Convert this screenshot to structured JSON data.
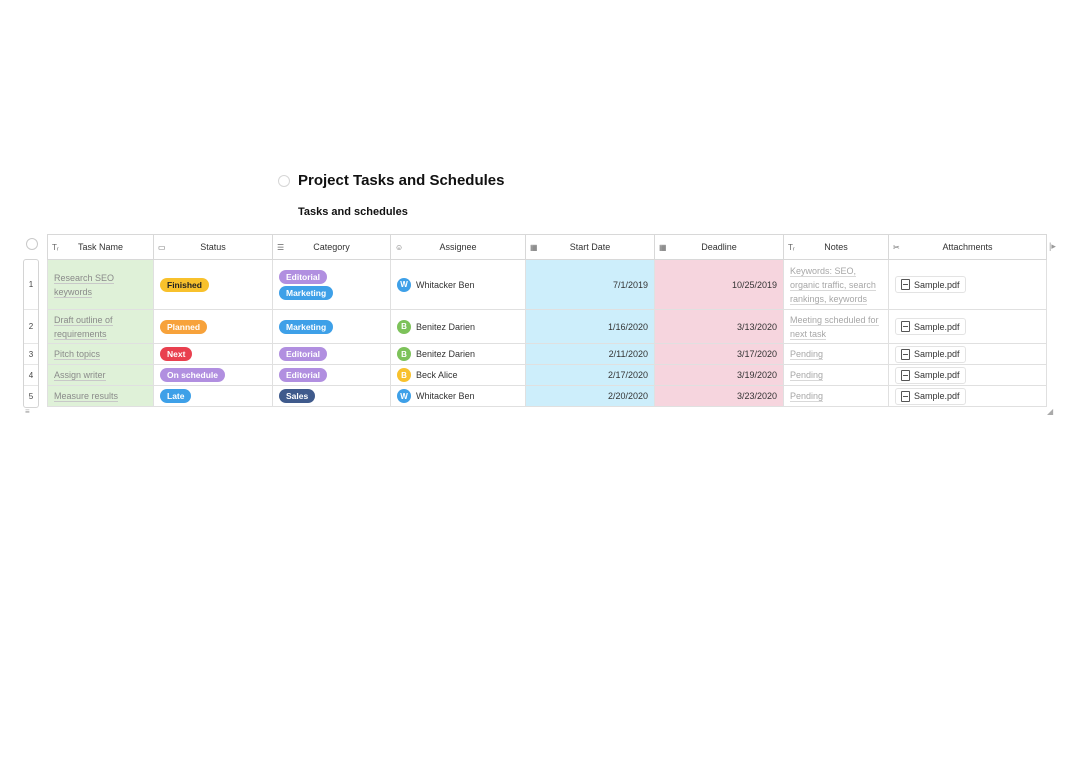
{
  "document": {
    "title": "Project Tasks and Schedules",
    "subtitle": "Tasks and schedules"
  },
  "table": {
    "columns": [
      {
        "key": "task",
        "label": "Task Name",
        "icon": "text-type-icon"
      },
      {
        "key": "status",
        "label": "Status",
        "icon": "single-select-icon"
      },
      {
        "key": "category",
        "label": "Category",
        "icon": "multi-select-icon"
      },
      {
        "key": "assignee",
        "label": "Assignee",
        "icon": "person-icon"
      },
      {
        "key": "start",
        "label": "Start Date",
        "icon": "calendar-icon"
      },
      {
        "key": "deadline",
        "label": "Deadline",
        "icon": "calendar-icon"
      },
      {
        "key": "notes",
        "label": "Notes",
        "icon": "text-type-icon"
      },
      {
        "key": "attachments",
        "label": "Attachments",
        "icon": "paperclip-icon"
      }
    ],
    "rows": [
      {
        "num": "1",
        "task": "Research SEO keywords",
        "status": {
          "label": "Finished",
          "color": "#f8c12c",
          "text_color": "#222"
        },
        "categories": [
          {
            "label": "Editorial",
            "color": "#b18fe0"
          },
          {
            "label": "Marketing",
            "color": "#3ea0e8"
          }
        ],
        "assignee": {
          "initial": "W",
          "name": "Whitacker Ben",
          "color": "#3ea0e8"
        },
        "start": "7/1/2019",
        "deadline": "10/25/2019",
        "notes": "Keywords: SEO, organic traffic, search rankings, keywords",
        "attachment": "Sample.pdf"
      },
      {
        "num": "2",
        "task": "Draft outline of requirements",
        "status": {
          "label": "Planned",
          "color": "#f7a23b",
          "text_color": "#fff"
        },
        "categories": [
          {
            "label": "Marketing",
            "color": "#3ea0e8"
          }
        ],
        "assignee": {
          "initial": "B",
          "name": "Benitez Darien",
          "color": "#7dc25a"
        },
        "start": "1/16/2020",
        "deadline": "3/13/2020",
        "notes": "Meeting scheduled for next task",
        "attachment": "Sample.pdf"
      },
      {
        "num": "3",
        "task": "Pitch topics",
        "status": {
          "label": "Next",
          "color": "#e9404f",
          "text_color": "#fff"
        },
        "categories": [
          {
            "label": "Editorial",
            "color": "#b18fe0"
          }
        ],
        "assignee": {
          "initial": "B",
          "name": "Benitez Darien",
          "color": "#7dc25a"
        },
        "start": "2/11/2020",
        "deadline": "3/17/2020",
        "notes": "Pending",
        "attachment": "Sample.pdf"
      },
      {
        "num": "4",
        "task": "Assign writer",
        "status": {
          "label": "On schedule",
          "color": "#b18fe0",
          "text_color": "#fff"
        },
        "categories": [
          {
            "label": "Editorial",
            "color": "#b18fe0"
          }
        ],
        "assignee": {
          "initial": "B",
          "name": "Beck Alice",
          "color": "#f8c12c"
        },
        "start": "2/17/2020",
        "deadline": "3/19/2020",
        "notes": "Pending",
        "attachment": "Sample.pdf"
      },
      {
        "num": "5",
        "task": "Measure results",
        "status": {
          "label": "Late",
          "color": "#3ea0e8",
          "text_color": "#fff"
        },
        "categories": [
          {
            "label": "Sales",
            "color": "#3f5a8c"
          }
        ],
        "assignee": {
          "initial": "W",
          "name": "Whitacker Ben",
          "color": "#3ea0e8"
        },
        "start": "2/20/2020",
        "deadline": "3/23/2020",
        "notes": "Pending",
        "attachment": "Sample.pdf"
      }
    ]
  }
}
